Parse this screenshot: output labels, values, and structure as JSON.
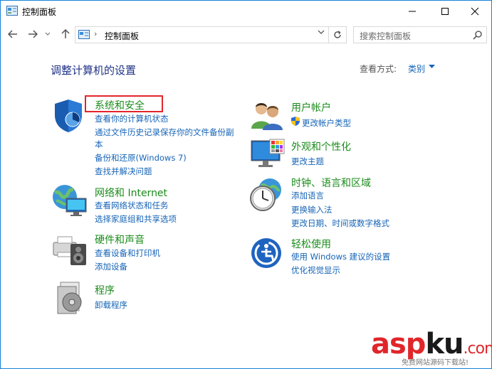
{
  "window": {
    "title": "控制面板",
    "controls": {
      "minimize": "minimize-icon",
      "maximize": "maximize-icon",
      "close": "close-icon"
    }
  },
  "addressbar": {
    "separator": "›",
    "path": "控制面板",
    "search_placeholder": "搜索控制面板"
  },
  "main": {
    "heading": "调整计算机的设置",
    "view_by_label": "查看方式:",
    "view_by_value": "类别"
  },
  "categories": {
    "system": {
      "title": "系统和安全",
      "links": [
        "查看你的计算机状态",
        "通过文件历史记录保存你的文件备份副",
        "本",
        "备份和还原(Windows 7)",
        "查找并解决问题"
      ]
    },
    "network": {
      "title": "网络和 Internet",
      "links": [
        "查看网络状态和任务",
        "选择家庭组和共享选项"
      ]
    },
    "hardware": {
      "title": "硬件和声音",
      "links": [
        "查看设备和打印机",
        "添加设备"
      ]
    },
    "programs": {
      "title": "程序",
      "links": [
        "卸载程序"
      ]
    },
    "users": {
      "title": "用户帐户",
      "links": [
        "更改帐户类型"
      ]
    },
    "appearance": {
      "title": "外观和个性化",
      "links": [
        "更改主题"
      ]
    },
    "clock": {
      "title": "时钟、语言和区域",
      "links": [
        "添加语言",
        "更换输入法",
        "更改日期、时间或数字格式"
      ]
    },
    "ease": {
      "title": "轻松使用",
      "links": [
        "使用 Windows 建议的设置",
        "优化视觉显示"
      ]
    }
  },
  "watermark": {
    "asp": "asp",
    "ku": "ku",
    "com": ".com",
    "sub": "免费网站源码下载站!"
  },
  "colors": {
    "link": "#1664b7",
    "category_title": "#1b8c1b",
    "heading": "#1e3287",
    "highlight": "#e3252b",
    "border": "#1883d7"
  }
}
